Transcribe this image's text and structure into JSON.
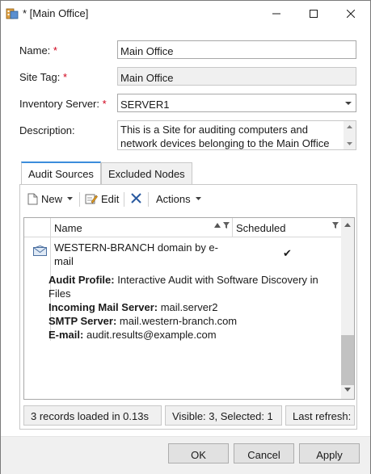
{
  "window": {
    "title": "* [Main Office]"
  },
  "form": {
    "name_label": "Name:",
    "name_value": "Main Office",
    "site_tag_label": "Site Tag:",
    "site_tag_value": "Main Office",
    "inventory_label": "Inventory Server:",
    "inventory_value": "SERVER1",
    "description_label": "Description:",
    "description_value": "This is a Site for auditing computers and network devices belonging to the Main Office",
    "required_marker": "*"
  },
  "tabs": [
    {
      "label": "Audit Sources",
      "active": true
    },
    {
      "label": "Excluded Nodes",
      "active": false
    }
  ],
  "toolbar": {
    "new_label": "New",
    "edit_label": "Edit",
    "actions_label": "Actions"
  },
  "grid": {
    "columns": [
      "Name",
      "Scheduled"
    ],
    "row": {
      "name": "WESTERN-BRANCH domain by e-mail",
      "scheduled": "✔",
      "details": [
        {
          "key": "Audit Profile:",
          "value": "Interactive Audit with Software Discovery in Files"
        },
        {
          "key": "Incoming Mail Server:",
          "value": "mail.server2"
        },
        {
          "key": "SMTP Server:",
          "value": "mail.western-branch.com"
        },
        {
          "key": "E-mail:",
          "value": "audit.results@example.com"
        }
      ]
    }
  },
  "status": {
    "records": "3 records loaded in 0.13s",
    "visible": "Visible: 3, Selected: 1",
    "refresh": "Last refresh:"
  },
  "buttons": {
    "ok": "OK",
    "cancel": "Cancel",
    "apply": "Apply"
  },
  "colors": {
    "accent": "#3c8ddc",
    "required": "#d0021b",
    "footer_bg": "#f0f0f0"
  }
}
